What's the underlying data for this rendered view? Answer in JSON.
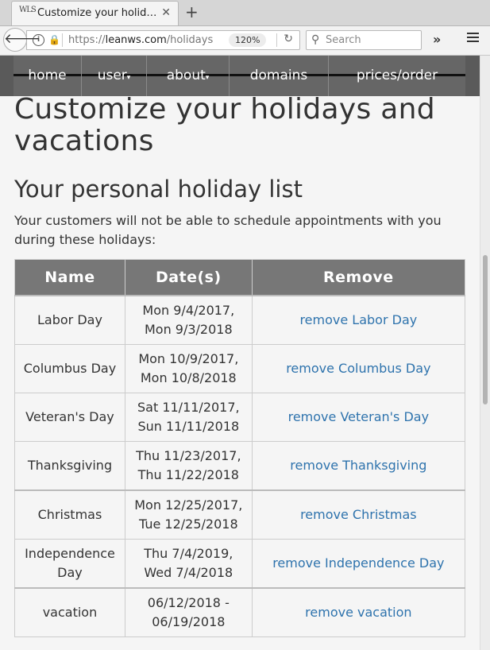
{
  "browser": {
    "tab_title": "Customize your holid…",
    "favicon_text": "WLS",
    "url_prefix": "https://",
    "url_domain": "leanws.com",
    "url_path": "/holidays",
    "zoom": "120%",
    "search_placeholder": "Search"
  },
  "nav": {
    "items": [
      {
        "label": "home"
      },
      {
        "label": "user"
      },
      {
        "label": "about"
      },
      {
        "label": "domains"
      },
      {
        "label": "prices/order"
      }
    ]
  },
  "page": {
    "title": "Customize your holidays and vacations",
    "subtitle": "Your personal holiday list",
    "intro": "Your customers will not be able to schedule appointments with you during these holidays:"
  },
  "table": {
    "headers": [
      "Name",
      "Date(s)",
      "Remove"
    ],
    "rows": [
      {
        "name": "Labor Day",
        "date1": "Mon 9/4/2017,",
        "date2": "Mon 9/3/2018",
        "remove": "remove Labor Day"
      },
      {
        "name": "Columbus Day",
        "date1": "Mon 10/9/2017,",
        "date2": "Mon 10/8/2018",
        "remove": "remove Columbus Day"
      },
      {
        "name": "Veteran's Day",
        "date1": "Sat 11/11/2017,",
        "date2": "Sun 11/11/2018",
        "remove": "remove Veteran's Day"
      },
      {
        "name": "Thanksgiving",
        "date1": "Thu 11/23/2017,",
        "date2": "Thu 11/22/2018",
        "remove": "remove Thanksgiving"
      },
      {
        "name": "Christmas",
        "date1": "Mon 12/25/2017,",
        "date2": "Tue 12/25/2018",
        "remove": "remove Christmas"
      },
      {
        "name1": "Independence",
        "name2": "Day",
        "date1": "Thu 7/4/2019,",
        "date2": "Wed 7/4/2018",
        "remove": "remove Independence Day"
      },
      {
        "name": "vacation",
        "date1": "06/12/2018 -",
        "date2": "06/19/2018",
        "remove": "remove vacation"
      }
    ]
  },
  "colors": {
    "nav_bg": "#666666",
    "table_header_bg": "#777777",
    "link": "#2e73ad"
  }
}
